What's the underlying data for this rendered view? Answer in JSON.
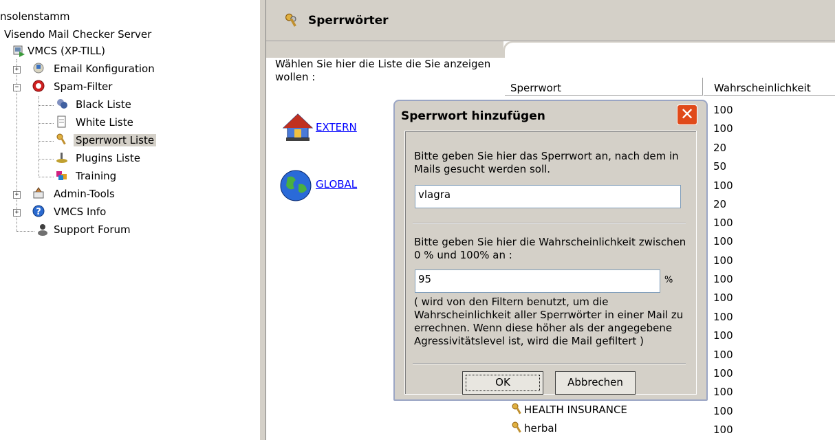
{
  "tree": {
    "root_label": "nsolenstamm",
    "server_label": "Visendo Mail Checker Server",
    "vmcs_label": "VMCS (XP-TILL)",
    "items": [
      {
        "label": "Email Konfiguration",
        "expander": "+"
      },
      {
        "label": "Spam-Filter",
        "expander": "−"
      },
      {
        "label": "Black Liste"
      },
      {
        "label": "White Liste"
      },
      {
        "label": "Sperrwort Liste"
      },
      {
        "label": "Plugins Liste"
      },
      {
        "label": "Training"
      },
      {
        "label": "Admin-Tools",
        "expander": "+"
      },
      {
        "label": "VMCS Info",
        "expander": "+"
      },
      {
        "label": "Support Forum"
      }
    ]
  },
  "header": {
    "title": "Sperrwörter"
  },
  "list_select": {
    "prompt": "Wählen Sie hier die Liste die Sie anzeigen wollen :",
    "extern_label": "EXTERN",
    "global_label": "GLOBAL"
  },
  "listview": {
    "col_word": "Sperrwort",
    "col_prob": "Wahrscheinlichkeit",
    "probabilities": [
      "100",
      "100",
      "20",
      "50",
      "100",
      "20",
      "100",
      "100",
      "100",
      "100",
      "100",
      "100",
      "100",
      "100",
      "100",
      "100",
      "100",
      "100"
    ],
    "visible_words": [
      "HEALTH INSURANCE",
      "herbal"
    ]
  },
  "dialog": {
    "title": "Sperrwort hinzufügen",
    "close_symbol": "✕",
    "word_prompt": "Bitte geben Sie hier das Sperrwort an, nach dem in Mails gesucht werden soll.",
    "word_value": "vlagra",
    "prob_prompt": "Bitte geben Sie hier die Wahrscheinlichkeit zwischen 0 % und 100% an :",
    "prob_value": "95",
    "prob_unit": "%",
    "note": "( wird von den Filtern benutzt, um die Wahrscheinlichkeit aller Sperrwörter in einer Mail zu errechnen. Wenn diese höher als der angegebene Agressivitätslevel ist, wird die Mail gefiltert )",
    "ok_label": "OK",
    "cancel_label": "Abbrechen"
  },
  "colors": {
    "dialog_bg": "#d4d0c8",
    "close_red": "#e04a1a",
    "link_blue": "#0000ff"
  }
}
